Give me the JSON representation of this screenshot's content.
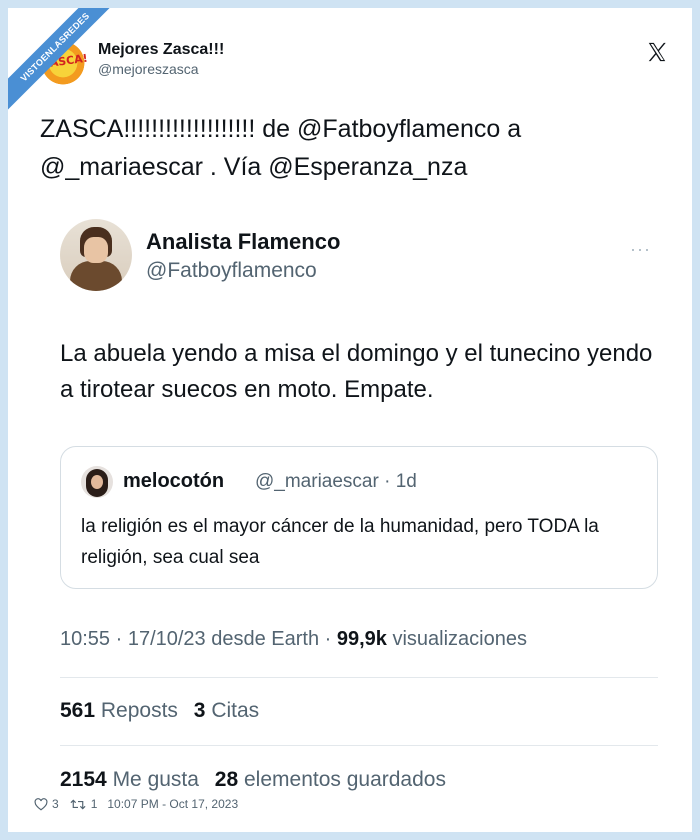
{
  "watermark": "VISTOENLASREDES",
  "author": {
    "avatar_text": "ZASCA!",
    "name": "Mejores Zasca!!!",
    "handle": "@mejoreszasca"
  },
  "tweet_text": "ZASCA!!!!!!!!!!!!!!!!!!! de @Fatboyflamenco a @_mariaescar . Vía @Esperanza_nza",
  "embedded": {
    "name": "Analista Flamenco",
    "handle": "@Fatboyflamenco",
    "more": "···",
    "text": "La abuela yendo a misa el domingo y el tunecino yendo a tirotear suecos en moto. Empate.",
    "quote": {
      "name": "melocotón",
      "meta": "@_mariaescar · 1d",
      "text": "la religión es el mayor cáncer de la humanidad, pero TODA la religión, sea cual sea"
    },
    "time": "10:55 · 17/10/23 desde Earth · ",
    "views_count": "99,9k",
    "views_label": " visualizaciones",
    "stats": {
      "reposts_count": "561",
      "reposts_label": "Reposts",
      "quotes_count": "3",
      "quotes_label": "Citas",
      "likes_count": "2154",
      "likes_label": "Me gusta",
      "bookmarks_count": "28",
      "bookmarks_label": "elementos guardados"
    }
  },
  "footer": {
    "likes": "3",
    "retweets": "1",
    "timestamp": "10:07 PM - Oct 17, 2023"
  }
}
